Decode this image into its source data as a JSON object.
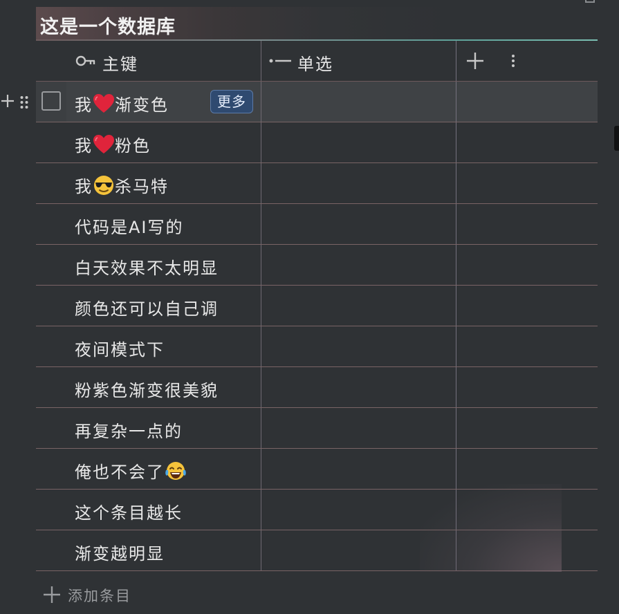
{
  "database": {
    "title": "这是一个数据库",
    "add_entry_label": "添加条目"
  },
  "columns": [
    {
      "label": "主键",
      "icon": "key-icon"
    },
    {
      "label": "单选",
      "icon": "single-select-icon"
    }
  ],
  "header_actions": {
    "add_column_icon": "plus-icon",
    "more_icon": "kebab-menu-icon"
  },
  "rows": [
    {
      "parts": [
        "我",
        "",
        "渐变色"
      ],
      "emoji": "red-heart-emoji",
      "hover": true,
      "more_label": "更多"
    },
    {
      "parts": [
        "我",
        "",
        "粉色"
      ],
      "emoji": "red-heart-emoji"
    },
    {
      "parts": [
        "我",
        "",
        "杀马特"
      ],
      "emoji": "sunglasses-emoji"
    },
    {
      "parts": [
        "代码是AI写的"
      ]
    },
    {
      "parts": [
        "白天效果不太明显"
      ]
    },
    {
      "parts": [
        "颜色还可以自己调"
      ]
    },
    {
      "parts": [
        "夜间模式下"
      ]
    },
    {
      "parts": [
        "粉紫色渐变很美貌"
      ]
    },
    {
      "parts": [
        "再复杂一点的"
      ]
    },
    {
      "parts": [
        "俺也不会了",
        ""
      ],
      "emoji": "tears-of-joy-emoji"
    },
    {
      "parts": [
        "这个条目越长"
      ]
    },
    {
      "parts": [
        "渐变越明显"
      ]
    }
  ],
  "colors": {
    "background": "#2f3235",
    "more_button": "#2f4a70",
    "title_gradient_start": "#5c4b4d",
    "underline_accent": "#7bbfb2"
  }
}
